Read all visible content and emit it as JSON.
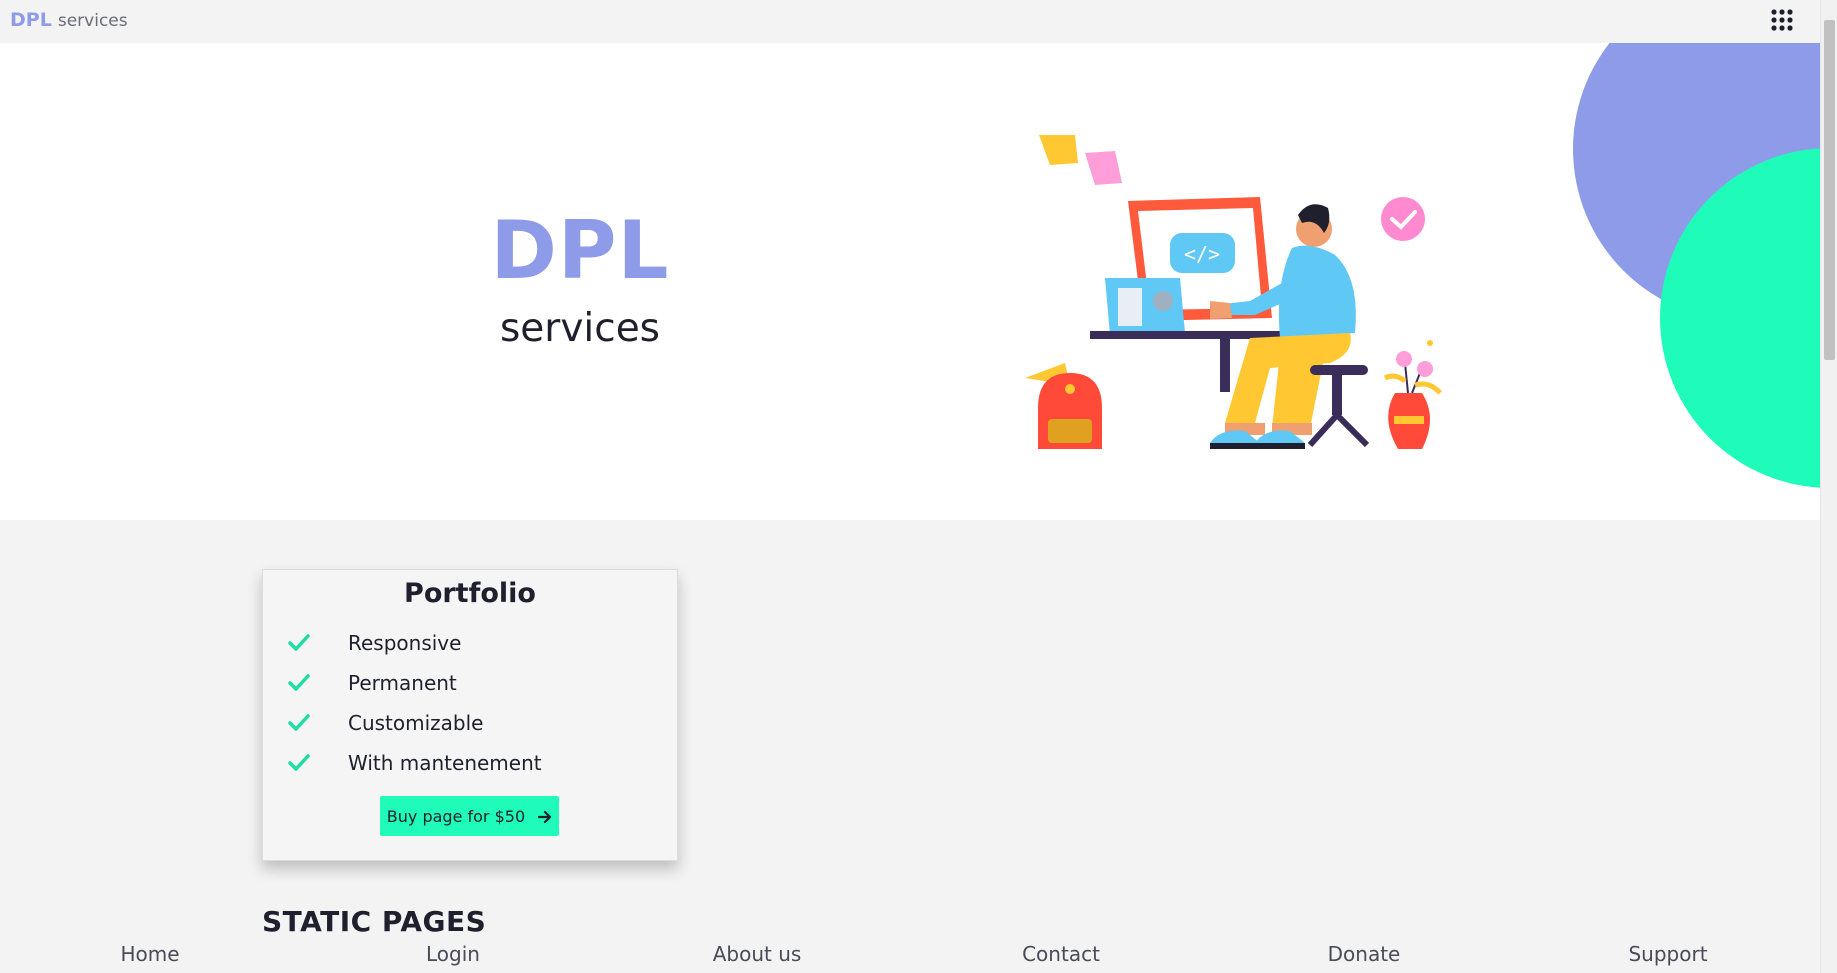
{
  "navbar": {
    "brand_strong": "DPL",
    "brand_light": "services",
    "apps_icon": "apps-grid-icon"
  },
  "hero": {
    "title": "DPL",
    "subtitle": "services",
    "illustration": "developer-at-computer-illustration"
  },
  "portfolio": {
    "title": "Portfolio",
    "features": [
      {
        "label": "Responsive",
        "icon": "check-icon"
      },
      {
        "label": "Permanent",
        "icon": "check-icon"
      },
      {
        "label": "Customizable",
        "icon": "check-icon"
      },
      {
        "label": "With mantenement",
        "icon": "check-icon"
      }
    ],
    "buy_label": "Buy page for $50",
    "buy_icon": "arrow-right-icon"
  },
  "static_pages": {
    "heading": "STATIC PAGES",
    "links": [
      "Home",
      "Login",
      "About us",
      "Contact",
      "Donate",
      "Support"
    ]
  },
  "colors": {
    "brand": "#8d9be8",
    "accent": "#1ffcb9",
    "background": "#f3f3f3",
    "check": "#1fdca5"
  }
}
